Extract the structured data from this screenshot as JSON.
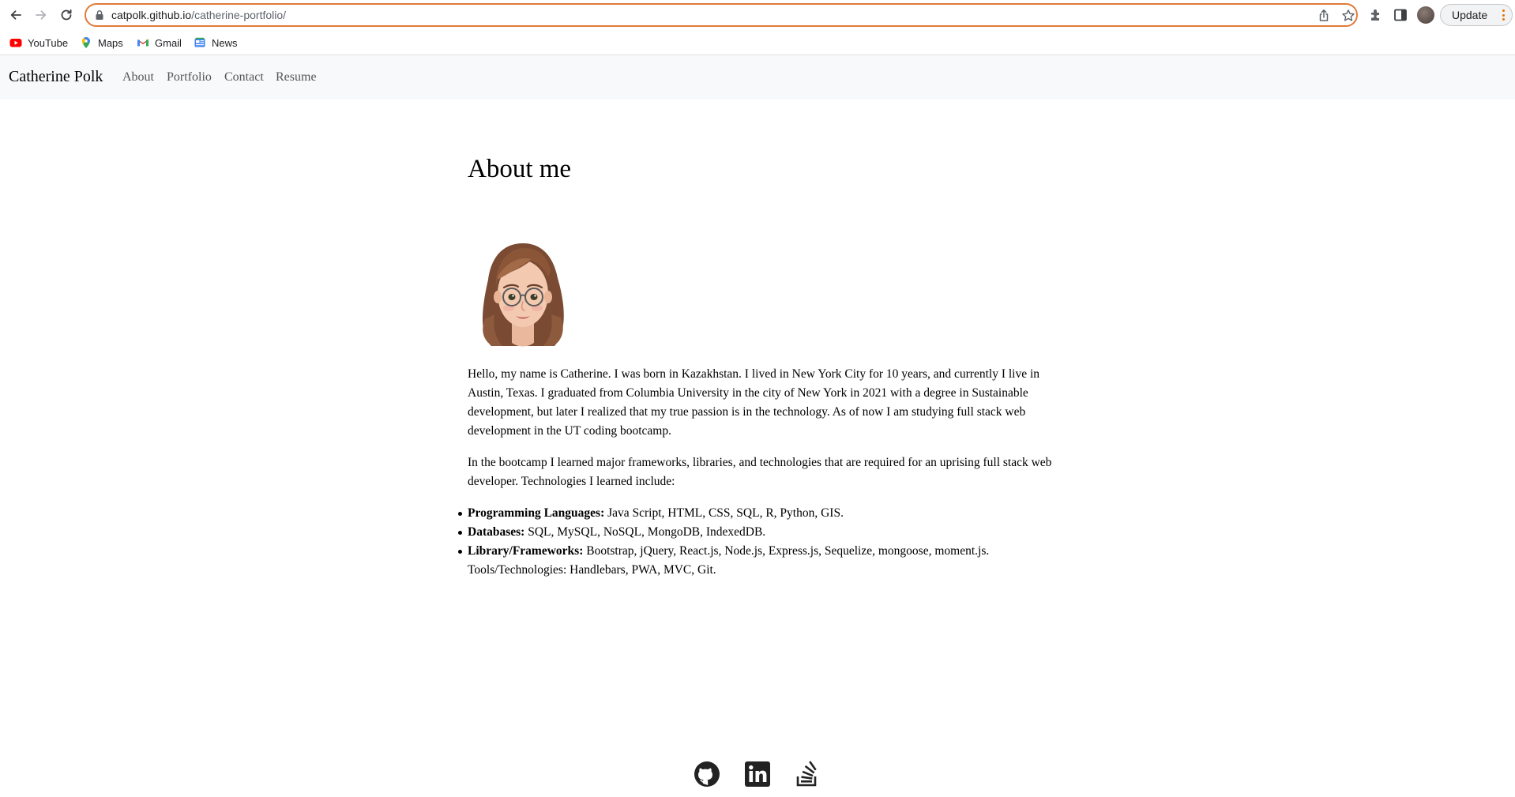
{
  "browser": {
    "url_host": "catpolk.github.io",
    "url_path": "/catherine-portfolio/",
    "update_label": "Update",
    "bookmarks": [
      {
        "label": "YouTube",
        "icon": "youtube-icon"
      },
      {
        "label": "Maps",
        "icon": "maps-icon"
      },
      {
        "label": "Gmail",
        "icon": "gmail-icon"
      },
      {
        "label": "News",
        "icon": "news-icon"
      }
    ],
    "accent": "#e07b39"
  },
  "navbar": {
    "brand": "Catherine Polk",
    "links": [
      "About",
      "Portfolio",
      "Contact",
      "Resume"
    ]
  },
  "main": {
    "title": "About me",
    "avatar_icon": "memoji-avatar",
    "paragraphs": [
      "Hello, my name is Catherine. I was born in Kazakhstan. I lived in New York City for 10 years, and currently I live in Austin, Texas. I graduated from Columbia University in the city of New York in 2021 with a degree in Sustainable development, but later I realized that my true passion is in the technology. As of now I am studying full stack web development in the UT coding bootcamp.",
      "In the bootcamp I learned major frameworks, libraries, and technologies that are required for an uprising full stack web developer. Technologies I learned include:"
    ],
    "skills": [
      {
        "label": "Programming Languages:",
        "text": " Java Script, HTML, CSS, SQL, R, Python, GIS."
      },
      {
        "label": "Databases:",
        "text": " SQL, MySQL, NoSQL, MongoDB, IndexedDB."
      },
      {
        "label": "Library/Frameworks:",
        "text": " Bootstrap, jQuery, React.js, Node.js, Express.js, Sequelize, mongoose, moment.js. Tools/Technologies: Handlebars, PWA, MVC, Git."
      }
    ]
  },
  "footer": {
    "icons": [
      "github-icon",
      "linkedin-icon",
      "stackoverflow-icon"
    ]
  }
}
